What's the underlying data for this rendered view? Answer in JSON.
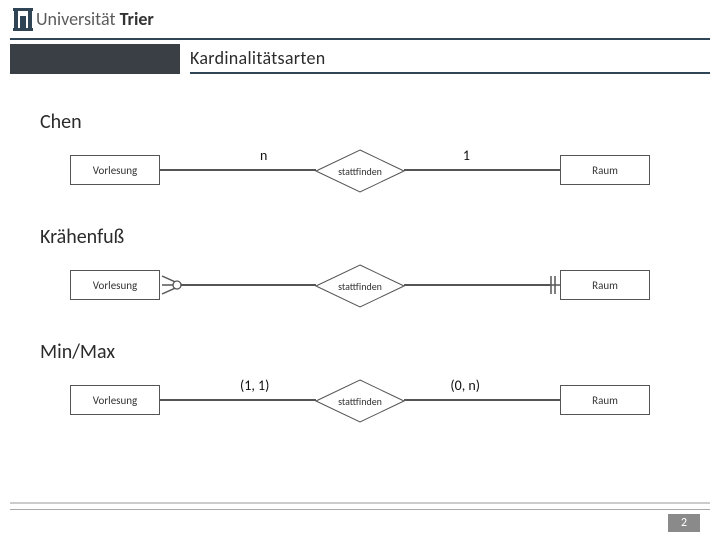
{
  "header": {
    "university_light": "Universität",
    "university_bold": "Trier",
    "title": "Kardinalitätsarten"
  },
  "sections": {
    "chen": "Chen",
    "crow": "Krähenfuß",
    "minmax": "Min/Max"
  },
  "er": {
    "entity_left": "Vorlesung",
    "entity_right": "Raum",
    "relationship": "stattfinden"
  },
  "cardinality": {
    "chen_left": "n",
    "chen_right": "1",
    "minmax_left": "(1, 1)",
    "minmax_right": "(0, n)"
  },
  "footer": {
    "page": "2"
  }
}
